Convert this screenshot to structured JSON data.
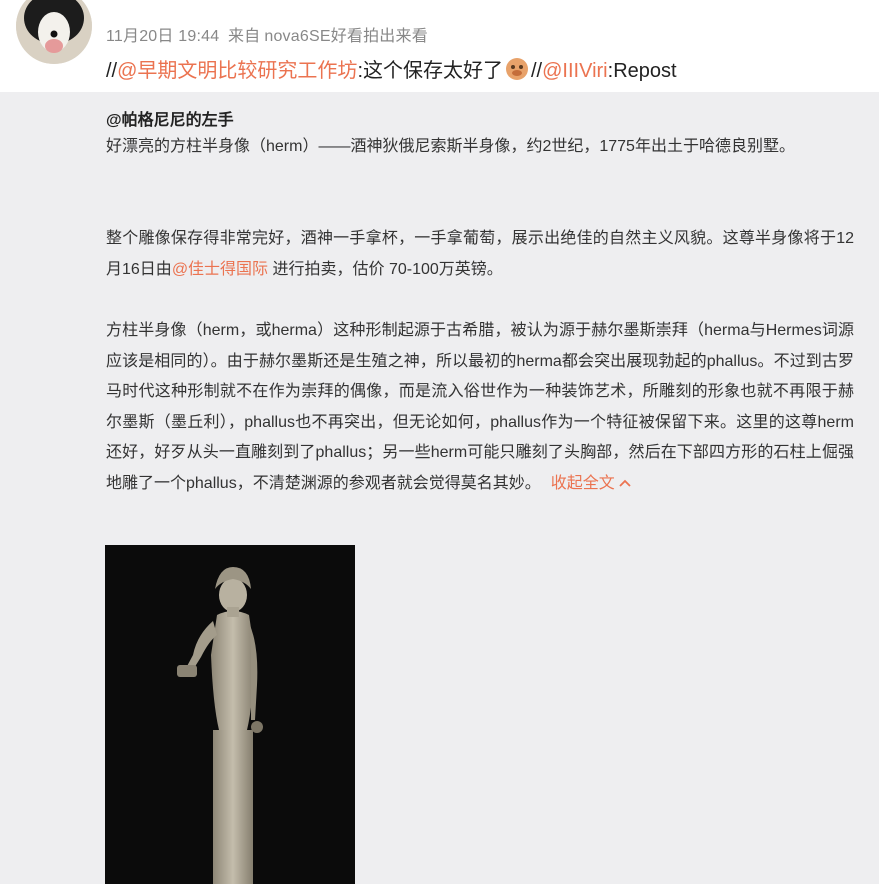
{
  "post": {
    "timestamp": "11月20日 19:44",
    "source_prefix": "来自",
    "source": "nova6SE好看拍出来看",
    "repost": {
      "sep1": "//",
      "mention1": "@早期文明比较研究工作坊",
      "colon1": ":",
      "text1": "这个保存太好了",
      "emoji": "doge-icon",
      "sep2": "//",
      "mention2": "@IIIViri",
      "colon2": ":",
      "text2": "Repost"
    }
  },
  "quoted": {
    "author": "@帕格尼尼的左手",
    "para1": "好漂亮的方柱半身像（herm）——酒神狄俄尼索斯半身像，约2世纪，1775年出土于哈德良别墅。",
    "para2_a": "整个雕像保存得非常完好，酒神一手拿杯，一手拿葡萄，展示出绝佳的自然主义风貌。这尊半身像将于12月16日由",
    "para2_mention": "@佳士得国际",
    "para2_b": " 进行拍卖，估价 70-100万英镑。",
    "para3": "方柱半身像（herm，或herma）这种形制起源于古希腊，被认为源于赫尔墨斯崇拜（herma与Hermes词源应该是相同的）。由于赫尔墨斯还是生殖之神，所以最初的herma都会突出展现勃起的phallus。不过到古罗马时代这种形制就不在作为崇拜的偶像，而是流入俗世作为一种装饰艺术，所雕刻的形象也就不再限于赫尔墨斯（墨丘利），phallus也不再突出，但无论如何，phallus作为一个特征被保留下来。这里的这尊herm还好，好歹从头一直雕刻到了phallus；另一些herm可能只雕刻了头胸部，然后在下部四方形的石柱上倔强地雕了一个phallus，不清楚渊源的参观者就会觉得莫名其妙。",
    "collapse_label": "收起全文",
    "collapse_icon": "chevron-up-icon"
  },
  "colors": {
    "accent": "#eb7350",
    "quoted_bg": "#eeeef0"
  }
}
